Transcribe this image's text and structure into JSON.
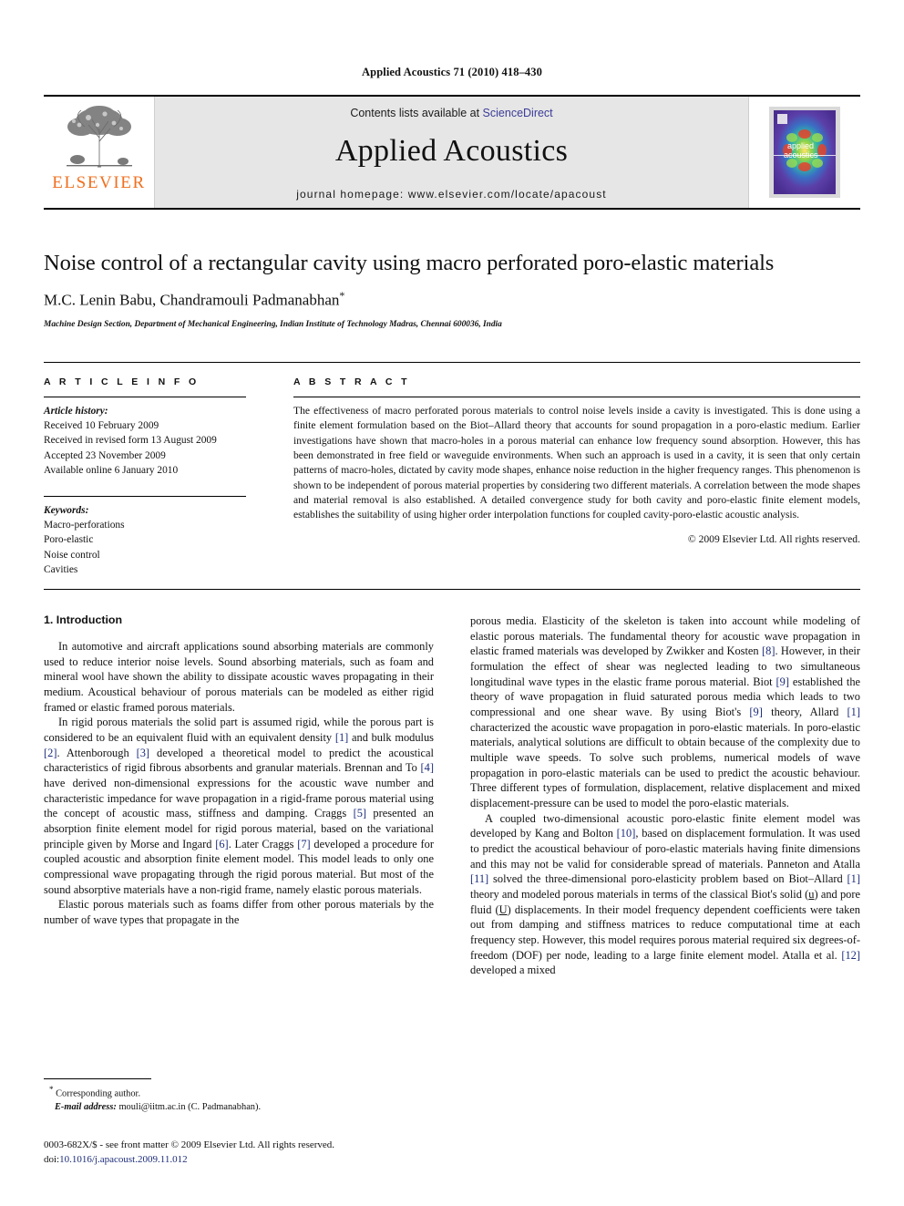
{
  "running_head": "Applied Acoustics 71 (2010) 418–430",
  "masthead": {
    "publisher_word": "ELSEVIER",
    "contents_prefix": "Contents lists available at ",
    "contents_link": "ScienceDirect",
    "journal_title": "Applied Acoustics",
    "homepage": "journal homepage: www.elsevier.com/locate/apacoust",
    "cover_line1": "applied",
    "cover_line2": "acoustics",
    "link_color": "#3b3b99",
    "brand_color": "#f06f1e"
  },
  "title_block": {
    "title": "Noise control of a rectangular cavity using macro perforated poro-elastic materials",
    "authors": "M.C. Lenin Babu, Chandramouli Padmanabhan",
    "corresponding_marker": "*",
    "affiliation": "Machine Design Section, Department of Mechanical Engineering, Indian Institute of Technology Madras, Chennai 600036, India"
  },
  "article_info": {
    "heading": "A R T I C L E    I N F O",
    "history_label": "Article history:",
    "history": [
      "Received 10 February 2009",
      "Received in revised form 13 August 2009",
      "Accepted 23 November 2009",
      "Available online 6 January 2010"
    ],
    "keywords_label": "Keywords:",
    "keywords": [
      "Macro-perforations",
      "Poro-elastic",
      "Noise control",
      "Cavities"
    ]
  },
  "abstract": {
    "heading": "A B S T R A C T",
    "text": "The effectiveness of macro perforated porous materials to control noise levels inside a cavity is investigated. This is done using a finite element formulation based on the Biot–Allard theory that accounts for sound propagation in a poro-elastic medium. Earlier investigations have shown that macro-holes in a porous material can enhance low frequency sound absorption. However, this has been demonstrated in free field or waveguide environments. When such an approach is used in a cavity, it is seen that only certain patterns of macro-holes, dictated by cavity mode shapes, enhance noise reduction in the higher frequency ranges. This phenomenon is shown to be independent of porous material properties by considering two different materials. A correlation between the mode shapes and material removal is also established. A detailed convergence study for both cavity and poro-elastic finite element models, establishes the suitability of using higher order interpolation functions for coupled cavity-poro-elastic acoustic analysis.",
    "copyright": "© 2009 Elsevier Ltd. All rights reserved."
  },
  "body": {
    "section_title": "1. Introduction",
    "left_paragraphs": [
      "In automotive and aircraft applications sound absorbing materials are commonly used to reduce interior noise levels. Sound absorbing materials, such as foam and mineral wool have shown the ability to dissipate acoustic waves propagating in their medium. Acoustical behaviour of porous materials can be modeled as either rigid framed or elastic framed porous materials.",
      "In rigid porous materials the solid part is assumed rigid, while the porous part is considered to be an equivalent fluid with an equivalent density [1] and bulk modulus [2]. Attenborough [3] developed a theoretical model to predict the acoustical characteristics of rigid fibrous absorbents and granular materials. Brennan and To [4] have derived non-dimensional expressions for the acoustic wave number and characteristic impedance for wave propagation in a rigid-frame porous material using the concept of acoustic mass, stiffness and damping. Craggs [5] presented an absorption finite element model for rigid porous material, based on the variational principle given by Morse and Ingard [6]. Later Craggs [7] developed a procedure for coupled acoustic and absorption finite element model. This model leads to only one compressional wave propagating through the rigid porous material. But most of the sound absorptive materials have a non-rigid frame, namely elastic porous materials.",
      "Elastic porous materials such as foams differ from other porous materials by the number of wave types that propagate in the"
    ],
    "right_paragraphs": [
      "porous media. Elasticity of the skeleton is taken into account while modeling of elastic porous materials. The fundamental theory for acoustic wave propagation in elastic framed materials was developed by Zwikker and Kosten [8]. However, in their formulation the effect of shear was neglected leading to two simultaneous longitudinal wave types in the elastic frame porous material. Biot [9] established the theory of wave propagation in fluid saturated porous media which leads to two compressional and one shear wave. By using Biot's [9] theory, Allard [1] characterized the acoustic wave propagation in poro-elastic materials. In poro-elastic materials, analytical solutions are difficult to obtain because of the complexity due to multiple wave speeds. To solve such problems, numerical models of wave propagation in poro-elastic materials can be used to predict the acoustic behaviour. Three different types of formulation, displacement, relative displacement and mixed displacement-pressure can be used to model the poro-elastic materials.",
      "A coupled two-dimensional acoustic poro-elastic finite element model was developed by Kang and Bolton [10], based on displacement formulation. It was used to predict the acoustical behaviour of poro-elastic materials having finite dimensions and this may not be valid for considerable spread of materials. Panneton and Atalla [11] solved the three-dimensional poro-elasticity problem based on Biot–Allard [1] theory and modeled porous materials in terms of the classical Biot's solid (u) and pore fluid (U) displacements. In their model frequency dependent coefficients were taken out from damping and stiffness matrices to reduce computational time at each frequency step. However, this model requires porous material required six degrees-of-freedom (DOF) per node, leading to a large finite element model. Atalla et al. [12] developed a mixed"
    ],
    "citation_color": "#1c2c7a"
  },
  "footnote": {
    "marker": "*",
    "corresponding": "Corresponding author.",
    "email_label": "E-mail address:",
    "email": "mouli@iitm.ac.in",
    "email_owner": "(C. Padmanabhan)."
  },
  "footer": {
    "issn_line": "0003-682X/$ - see front matter © 2009 Elsevier Ltd. All rights reserved.",
    "doi_label": "doi:",
    "doi_value": "10.1016/j.apacoust.2009.11.012"
  }
}
